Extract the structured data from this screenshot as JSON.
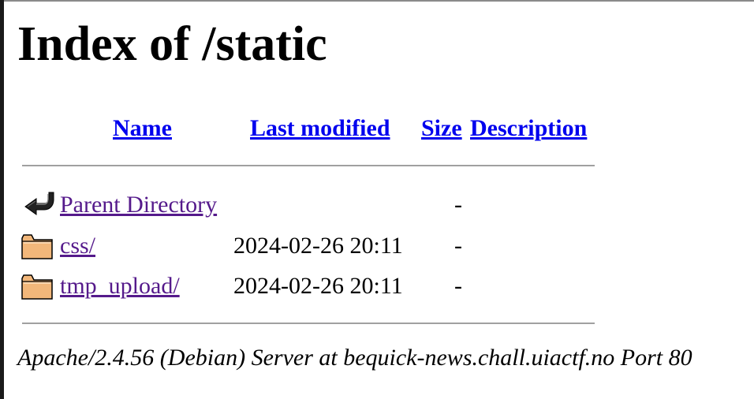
{
  "page_title": "Index of /static",
  "columns": {
    "name": "Name",
    "last_modified": "Last modified",
    "size": "Size",
    "description": "Description"
  },
  "rows": [
    {
      "icon": "back-arrow-icon",
      "name": "Parent Directory",
      "last_modified": "",
      "size": "-"
    },
    {
      "icon": "folder-icon",
      "name": "css/",
      "last_modified": "2024-02-26 20:11",
      "size": "-"
    },
    {
      "icon": "folder-icon",
      "name": "tmp_upload/",
      "last_modified": "2024-02-26 20:11",
      "size": "-"
    }
  ],
  "footer": "Apache/2.4.56 (Debian) Server at bequick-news.chall.uiactf.no Port 80",
  "colors": {
    "link": "#0000ee",
    "visited_link": "#551a8b",
    "folder_fill": "#f2b77a",
    "rule": "#a0a0a0"
  }
}
